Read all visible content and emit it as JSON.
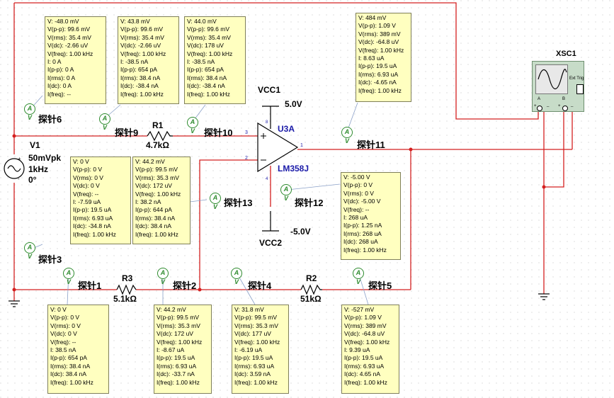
{
  "components": {
    "v1": {
      "name": "V1",
      "amplitude": "50mVpk",
      "freq": "1kHz",
      "phase": "0°"
    },
    "r1": {
      "name": "R1",
      "value": "4.7kΩ"
    },
    "r2": {
      "name": "R2",
      "value": "51kΩ"
    },
    "r3": {
      "name": "R3",
      "value": "5.1kΩ"
    },
    "opamp": {
      "ref": "U3A",
      "part": "LM358J",
      "pin_in_plus": "3",
      "pin_in_minus": "2",
      "pin_out": "1",
      "pin_vcc": "8",
      "pin_vee": "4"
    },
    "vcc1": {
      "name": "VCC1",
      "value": "5.0V"
    },
    "vcc2": {
      "name": "VCC2",
      "value": "-5.0V"
    },
    "scope": {
      "name": "XSC1",
      "ext_trig": "Ext Trig",
      "ch_a": "A",
      "ch_b": "B",
      "plus": "+",
      "minus": "_"
    }
  },
  "probe_symbol": "A V",
  "probes": [
    {
      "label": "探针1",
      "lines": [
        "V: 0 V",
        "V(p-p): 0 V",
        "V(rms): 0 V",
        "V(dc): 0 V",
        "V(freq): --",
        "I: 38.5 nA",
        "I(p-p): 654 pA",
        "I(rms): 38.4 nA",
        "I(dc): 38.4 nA",
        "I(freq): 1.00 kHz"
      ]
    },
    {
      "label": "探针2",
      "lines": [
        "V: 44.2 mV",
        "V(p-p): 99.5 mV",
        "V(rms): 35.3 mV",
        "V(dc): 172 uV",
        "V(freq): 1.00 kHz",
        "I: -8.67 uA",
        "I(p-p): 19.5 uA",
        "I(rms): 6.93 uA",
        "I(dc): -33.7 nA",
        "I(freq): 1.00 kHz"
      ]
    },
    {
      "label": "探针3",
      "lines": [
        "V: 0 V",
        "V(p-p): 0 V",
        "V(rms): 0 V",
        "V(dc): 0 V",
        "V(freq): --",
        "I: -7.59 uA",
        "I(p-p): 19.5 uA",
        "I(rms): 6.93 uA",
        "I(dc): -34.8 nA",
        "I(freq): 1.00 kHz"
      ]
    },
    {
      "label": "探针4",
      "lines": [
        "V: 31.8 mV",
        "V(p-p): 99.5 mV",
        "V(rms): 35.3 mV",
        "V(dc): 177 uV",
        "V(freq): 1.00 kHz",
        "I: -6.19 uA",
        "I(p-p): 19.5 uA",
        "I(rms): 6.93 uA",
        "I(dc): 3.59 nA",
        "I(freq): 1.00 kHz"
      ]
    },
    {
      "label": "探针5",
      "lines": [
        "V: -527 mV",
        "V(p-p): 1.09 V",
        "V(rms): 389 mV",
        "V(dc): -64.8 uV",
        "V(freq): 1.00 kHz",
        "I: 9.39 uA",
        "I(p-p): 19.5 uA",
        "I(rms): 6.93 uA",
        "I(dc): 4.65 nA",
        "I(freq): 1.00 kHz"
      ]
    },
    {
      "label": "探针6",
      "lines": [
        "V: -48.0 mV",
        "V(p-p): 99.6 mV",
        "V(rms): 35.4 mV",
        "V(dc): -2.66 uV",
        "V(freq): 1.00 kHz",
        "I: 0 A",
        "I(p-p): 0 A",
        "I(rms): 0 A",
        "I(dc): 0 A",
        "I(freq): --"
      ]
    },
    {
      "label": "探针9",
      "lines": [
        "V: 43.8 mV",
        "V(p-p): 99.6 mV",
        "V(rms): 35.4 mV",
        "V(dc): -2.66 uV",
        "V(freq): 1.00 kHz",
        "I: -38.5 nA",
        "I(p-p): 654 pA",
        "I(rms): 38.4 nA",
        "I(dc): -38.4 nA",
        "I(freq): 1.00 kHz"
      ]
    },
    {
      "label": "探针10",
      "lines": [
        "V: 44.0 mV",
        "V(p-p): 99.6 mV",
        "V(rms): 35.4 mV",
        "V(dc): 178 uV",
        "V(freq): 1.00 kHz",
        "I: -38.5 nA",
        "I(p-p): 654 pA",
        "I(rms): 38.4 nA",
        "I(dc): -38.4 nA",
        "I(freq): 1.00 kHz"
      ]
    },
    {
      "label": "探针11",
      "lines": [
        "V: 484 mV",
        "V(p-p): 1.09 V",
        "V(rms): 389 mV",
        "V(dc): -64.8 uV",
        "V(freq): 1.00 kHz",
        "I: 8.63 uA",
        "I(p-p): 19.5 uA",
        "I(rms): 6.93 uA",
        "I(dc): -4.65 nA",
        "I(freq): 1.00 kHz"
      ]
    },
    {
      "label": "探针12",
      "lines": [
        "V: -5.00 V",
        "V(p-p): 0 V",
        "V(rms): 0 V",
        "V(dc): -5.00 V",
        "V(freq): --",
        "I: 268 uA",
        "I(p-p): 1.25 nA",
        "I(rms): 268 uA",
        "I(dc): 268 uA",
        "I(freq): 1.00 kHz"
      ]
    },
    {
      "label": "探针13",
      "lines": [
        "V: 44.2 mV",
        "V(p-p): 99.5 mV",
        "V(rms): 35.3 mV",
        "V(dc): 172 uV",
        "V(freq): 1.00 kHz",
        "I: 38.2 nA",
        "I(p-p): 644 pA",
        "I(rms): 38.4 nA",
        "I(dc): 38.4 nA",
        "I(freq): 1.00 kHz"
      ]
    }
  ],
  "colors": {
    "wire": "#d42020",
    "probe": "#2e8b2e",
    "probe_box": "#ffffc0",
    "opamp_label": "#1a1aa8",
    "grid_dot": "#c8c8c8"
  }
}
